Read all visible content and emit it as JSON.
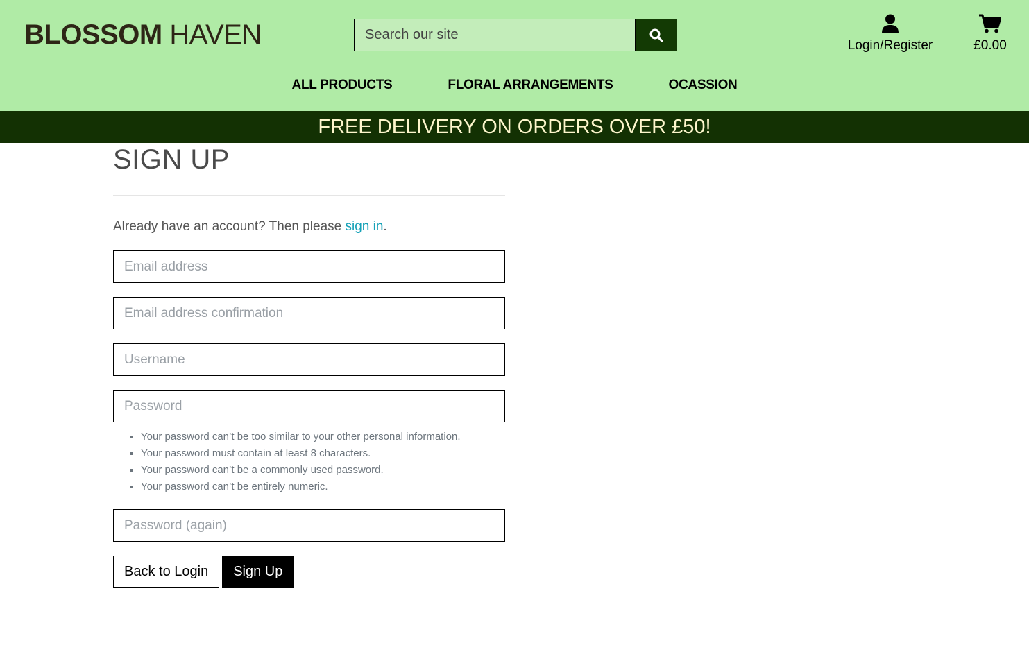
{
  "header": {
    "logo_bold": "BLOSSOM",
    "logo_light": "HAVEN",
    "search_placeholder": "Search our site",
    "search_icon": "magnifier-icon",
    "account_icon": "user-icon",
    "account_label": "Login/Register",
    "cart_icon": "cart-icon",
    "cart_total": "£0.00",
    "bg_color": "#b0eba6",
    "nav": [
      {
        "label": "ALL PRODUCTS"
      },
      {
        "label": "FLORAL ARRANGEMENTS"
      },
      {
        "label": "OCASSION"
      }
    ]
  },
  "banner": {
    "text": "FREE DELIVERY ON ORDERS OVER £50!",
    "bg_color": "#133103"
  },
  "signup": {
    "title": "SIGN UP",
    "intro_text": "Already have an account? Then please ",
    "intro_link": "sign in",
    "intro_end": ".",
    "email_placeholder": "Email address",
    "email_confirm_placeholder": "Email address confirmation",
    "username_placeholder": "Username",
    "password_placeholder": "Password",
    "password_help": [
      "Your password can’t be too similar to your other personal information.",
      "Your password must contain at least 8 characters.",
      "Your password can’t be a commonly used password.",
      "Your password can’t be entirely numeric."
    ],
    "password_again_placeholder": "Password (again)",
    "back_button": "Back to Login",
    "submit_button": "Sign Up"
  }
}
